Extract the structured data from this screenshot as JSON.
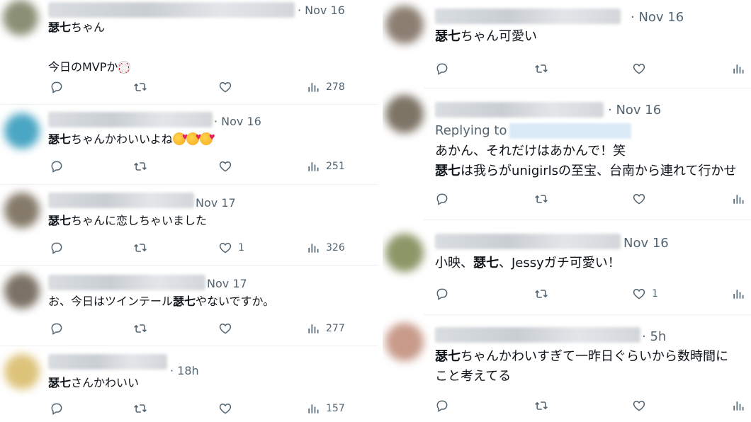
{
  "left": {
    "tweets": [
      {
        "time": "· Nov 16",
        "lines": [
          {
            "segments": [
              {
                "t": "瑟七",
                "b": true
              },
              {
                "t": "ちゃん",
                "b": false
              }
            ]
          },
          {
            "segments": []
          },
          {
            "segments": [
              {
                "t": "今日のMVPか",
                "b": false
              }
            ],
            "emoji": "baseball"
          }
        ],
        "likes": "",
        "views": "278"
      },
      {
        "time": "· Nov 16",
        "lines": [
          {
            "segments": [
              {
                "t": "瑟七",
                "b": true
              },
              {
                "t": "ちゃんかわいいよね",
                "b": false
              }
            ],
            "emoji": "smiling-face-with-hearts-x3"
          }
        ],
        "likes": "",
        "views": "251"
      },
      {
        "time": "Nov 17",
        "lines": [
          {
            "segments": [
              {
                "t": "瑟七",
                "b": true
              },
              {
                "t": "ちゃんに恋しちゃいました",
                "b": false
              }
            ]
          }
        ],
        "likes": "1",
        "views": "326"
      },
      {
        "time": "Nov 17",
        "lines": [
          {
            "segments": [
              {
                "t": "お、今日はツインテール",
                "b": false
              },
              {
                "t": "瑟七",
                "b": true
              },
              {
                "t": "やないですか。",
                "b": false
              }
            ]
          }
        ],
        "likes": "",
        "views": "277"
      },
      {
        "time": "· 18h",
        "lines": [
          {
            "segments": [
              {
                "t": "瑟七",
                "b": true
              },
              {
                "t": "さんかわいい",
                "b": false
              }
            ]
          }
        ],
        "likes": "",
        "views": "157"
      }
    ]
  },
  "right": {
    "tweets": [
      {
        "time": "· Nov 16",
        "lines": [
          {
            "segments": [
              {
                "t": "瑟七",
                "b": true
              },
              {
                "t": "ちゃん可愛い",
                "b": false
              }
            ]
          }
        ],
        "likes": ""
      },
      {
        "time": "· Nov 16",
        "replying": "Replying to",
        "lines": [
          {
            "segments": [
              {
                "t": "あかん、それだけはあかんで！笑",
                "b": false
              }
            ]
          },
          {
            "segments": [
              {
                "t": "瑟七",
                "b": true
              },
              {
                "t": "は我らがunigirlsの至宝、台南から連れて行かせ",
                "b": false
              }
            ]
          }
        ],
        "likes": ""
      },
      {
        "time": "Nov 16",
        "lines": [
          {
            "segments": [
              {
                "t": "小映、",
                "b": false
              },
              {
                "t": "瑟七",
                "b": true
              },
              {
                "t": "、Jessyガチ可愛い！",
                "b": false
              }
            ]
          }
        ],
        "likes": "1"
      },
      {
        "time": "· 5h",
        "lines": [
          {
            "segments": [
              {
                "t": "瑟七",
                "b": true
              },
              {
                "t": "ちゃんかわいすぎて一昨日ぐらいから数時間に",
                "b": false
              }
            ]
          },
          {
            "segments": [
              {
                "t": "こと考えてる",
                "b": false
              }
            ]
          }
        ],
        "likes": ""
      }
    ]
  },
  "icons": [
    "reply-icon",
    "retweet-icon",
    "like-icon",
    "views-icon"
  ],
  "colors": {
    "text": "#0f1419",
    "muted": "#536471",
    "divider": "#eceff1"
  }
}
